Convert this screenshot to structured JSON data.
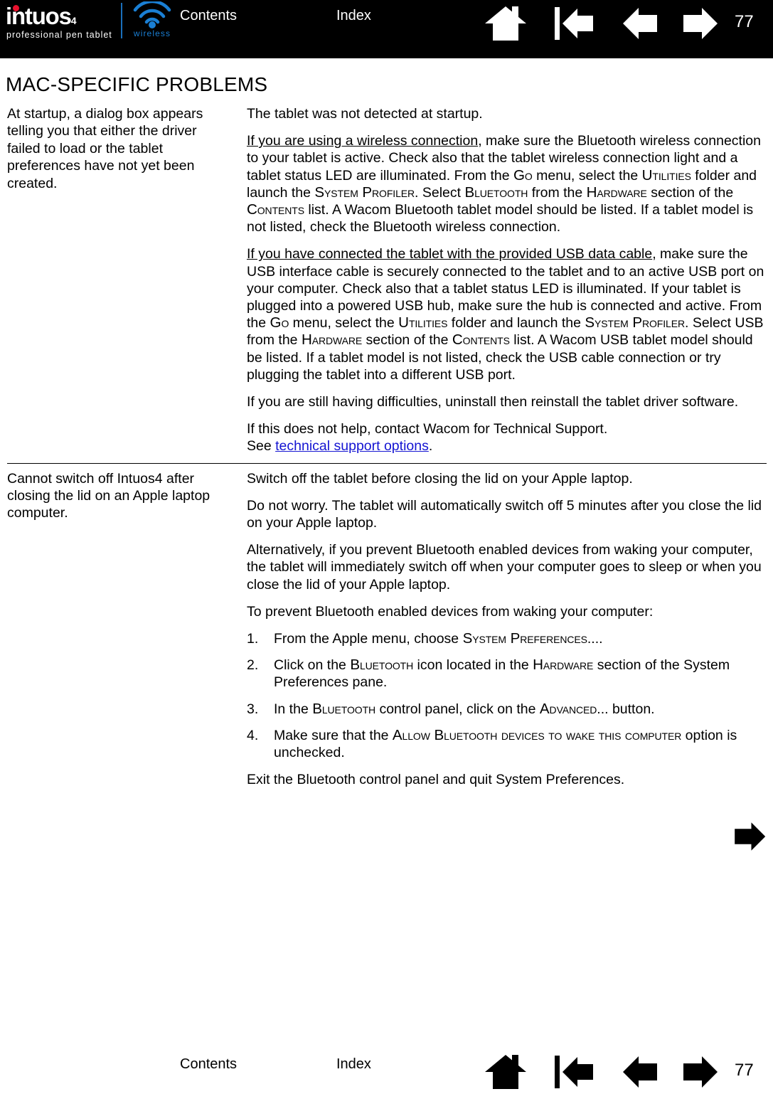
{
  "header": {
    "logo": {
      "word": "intuos",
      "superscript": "4",
      "tagline": "professional pen tablet",
      "wireless_label": "wireless",
      "dot_color": "#e8112d",
      "wireless_color": "#1a7fd4"
    },
    "contents_label": "Contents",
    "index_label": "Index",
    "page_number": "77",
    "icons": [
      "home-icon",
      "first-page-icon",
      "previous-page-icon",
      "next-page-icon"
    ]
  },
  "page_title": "MAC-SPECIFIC PROBLEMS",
  "table": {
    "rows": [
      {
        "problem": "At startup, a dialog box appears telling you that either the driver failed to load or the tablet preferences have not yet been created.",
        "solution_paragraphs": [
          "The tablet was not detected at startup.",
          "If you are using a wireless connection, make sure the Bluetooth wireless connection to your tablet is active.  Check also that the tablet wireless connection light and  a tablet status LED are illuminated.  From the GO menu, select the UTILITIES folder and launch the SYSTEM PROFILER.  Select BLUETOOTH from the HARDWARE section of the CONTENTS list.  A Wacom Bluetooth tablet model should be listed.  If a tablet model is not listed, check the Bluetooth wireless connection.",
          "If you have connected the tablet with the provided USB data cable, make sure the USB interface cable is securely connected to the tablet and to an active USB port on your computer.  Check also that a tablet status LED is illuminated.  If your tablet is plugged into a powered USB hub, make sure the hub is connected and active.  From the GO menu, select the UTILITIES folder and launch the SYSTEM PROFILER.  Select USB from the HARDWARE section of the CONTENTS list.  A Wacom USB tablet model should be listed.  If a tablet model is not listed, check the USB cable connection or try plugging the tablet into a different USB port.",
          "If you are still having difficulties, uninstall then reinstall the tablet driver software.",
          "If this does not help, contact Wacom for Technical Support. See technical support options."
        ],
        "fragments": {
          "p1": "The tablet was not detected at startup.",
          "p2_underlined": "If you are using a wireless connection",
          "p2_a": ", make sure the Bluetooth wireless connection to your tablet is active.  Check also that the tablet wireless connection light and  a tablet status LED are illuminated.  From the ",
          "p2_sc1": "Go",
          "p2_b": " menu, select the ",
          "p2_sc2": "Utilities",
          "p2_c": " folder and launch the ",
          "p2_sc3": "System Profiler",
          "p2_d": ".  Select ",
          "p2_sc4": "Bluetooth",
          "p2_e": " from the ",
          "p2_sc5": "Hardware",
          "p2_f": " section of the ",
          "p2_sc6": "Contents",
          "p2_g": " list.  A Wacom Bluetooth tablet model should be listed.  If a tablet model is not listed, check the Bluetooth wireless connection.",
          "p3_underlined": "If you have connected the tablet with the provided USB data cable",
          "p3_a": ", make sure the USB interface cable is securely connected to the tablet and to an active USB port on your computer.  Check also that a tablet status LED is illuminated.  If your tablet is plugged into a powered USB hub, make sure the hub is connected and active.  From the ",
          "p3_sc1": "Go",
          "p3_b": " menu, select the ",
          "p3_sc2": "Utilities",
          "p3_c": " folder and launch the ",
          "p3_sc3": "System Profiler",
          "p3_d": ".  Select USB from the ",
          "p3_sc4": "Hardware",
          "p3_e": " section of the ",
          "p3_sc5": "Contents",
          "p3_f": " list.  A Wacom USB tablet model should be listed.  If a tablet model is not listed, check the USB cable connection or try plugging the tablet into a different USB port.",
          "p4": "If you are still having difficulties, uninstall then reinstall the tablet driver software.",
          "p5_a": "If this does not help, contact Wacom for Technical Support.",
          "p5_b": "See ",
          "p5_link": "technical support options",
          "p5_c": "."
        }
      },
      {
        "problem": "Cannot switch off Intuos4 after closing the lid on an Apple laptop computer.",
        "fragments": {
          "p1": "Switch off the tablet before closing the lid on your Apple laptop.",
          "p2": "Do not worry.  The tablet will automatically switch off 5 minutes after you close the lid on your Apple laptop.",
          "p3": "Alternatively, if you prevent Bluetooth enabled devices from waking your computer, the tablet will immediately switch off when your computer goes to sleep or when you close the lid of your Apple laptop.",
          "p4": "To prevent Bluetooth enabled devices from waking your computer:",
          "steps": [
            {
              "num": "1.",
              "a": "From the Apple menu, choose ",
              "sc": "System Preferences",
              "b": "...."
            },
            {
              "num": "2.",
              "a": "Click on the ",
              "sc": "Bluetooth",
              "b": " icon located in the ",
              "sc2": "Hardware",
              "c": " section of the System Preferences pane."
            },
            {
              "num": "3.",
              "a": "In the ",
              "sc": "Bluetooth",
              "b": " control panel, click on the ",
              "sc2": "Advanced",
              "c": "... button."
            },
            {
              "num": "4.",
              "a": "Make sure that the ",
              "sc": "Allow Bluetooth devices to wake this computer",
              "b": " option is unchecked."
            }
          ],
          "p5": "Exit the Bluetooth control panel and quit System Preferences."
        }
      }
    ]
  },
  "footer": {
    "contents_label": "Contents",
    "index_label": "Index",
    "page_number": "77",
    "icons": [
      "home-icon",
      "first-page-icon",
      "previous-page-icon",
      "next-page-icon"
    ]
  },
  "colors": {
    "header_background": "#000000",
    "link": "#1414d2",
    "accent_red": "#e8112d",
    "accent_blue": "#1a7fd4"
  }
}
